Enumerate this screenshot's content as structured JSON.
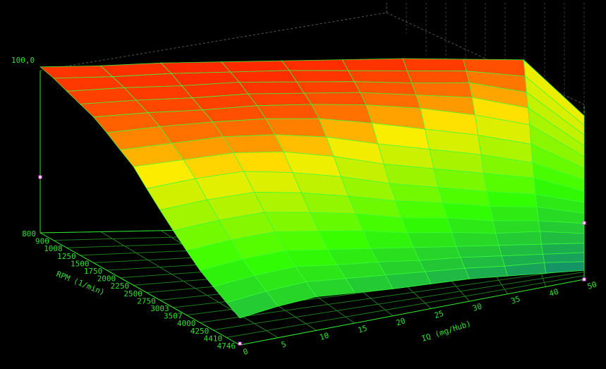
{
  "chart_data": {
    "type": "surface3d",
    "z_tick_label": "100,0",
    "x_axis": {
      "label": "IQ (mg/Hub)",
      "ticks": [
        "0",
        "5",
        "10",
        "15",
        "20",
        "25",
        "30",
        "35",
        "40",
        "50"
      ]
    },
    "y_axis": {
      "label": "RPM (1/min)",
      "ticks": [
        "800",
        "900",
        "1008",
        "1250",
        "1500",
        "1750",
        "2000",
        "2250",
        "2500",
        "2750",
        "3003",
        "3507",
        "4000",
        "4250",
        "4410",
        "4746"
      ]
    },
    "z_range": [
      0,
      100
    ],
    "grid": "on",
    "colors": {
      "background": "#000000",
      "grid": "#2fe02f",
      "low": "#0a6e8c",
      "mid": "#33ff00",
      "high": "#ff2a00"
    },
    "z_values": [
      [
        96,
        96,
        97,
        97,
        97,
        97,
        97,
        96,
        95,
        62
      ],
      [
        96,
        96,
        97,
        97,
        97,
        96,
        95,
        94,
        90,
        60
      ],
      [
        95,
        96,
        96,
        97,
        96,
        95,
        93,
        92,
        85,
        58
      ],
      [
        94,
        95,
        95,
        96,
        95,
        94,
        91,
        88,
        80,
        55
      ],
      [
        93,
        94,
        94,
        95,
        94,
        92,
        88,
        82,
        74,
        52
      ],
      [
        90,
        92,
        93,
        93,
        91,
        86,
        80,
        74,
        66,
        48
      ],
      [
        86,
        88,
        90,
        89,
        85,
        78,
        72,
        66,
        58,
        44
      ],
      [
        82,
        84,
        86,
        84,
        78,
        70,
        64,
        58,
        52,
        40
      ],
      [
        74,
        78,
        80,
        76,
        70,
        62,
        56,
        50,
        45,
        36
      ],
      [
        66,
        70,
        72,
        68,
        62,
        55,
        50,
        44,
        40,
        32
      ],
      [
        58,
        62,
        64,
        60,
        55,
        48,
        44,
        38,
        34,
        28
      ],
      [
        50,
        54,
        56,
        52,
        48,
        42,
        38,
        33,
        30,
        24
      ],
      [
        42,
        46,
        48,
        44,
        40,
        36,
        32,
        28,
        24,
        20
      ],
      [
        36,
        40,
        42,
        38,
        35,
        31,
        28,
        24,
        20,
        16
      ],
      [
        30,
        34,
        36,
        33,
        30,
        27,
        24,
        20,
        17,
        12
      ],
      [
        24,
        28,
        30,
        27,
        24,
        22,
        20,
        16,
        12,
        8
      ]
    ]
  }
}
